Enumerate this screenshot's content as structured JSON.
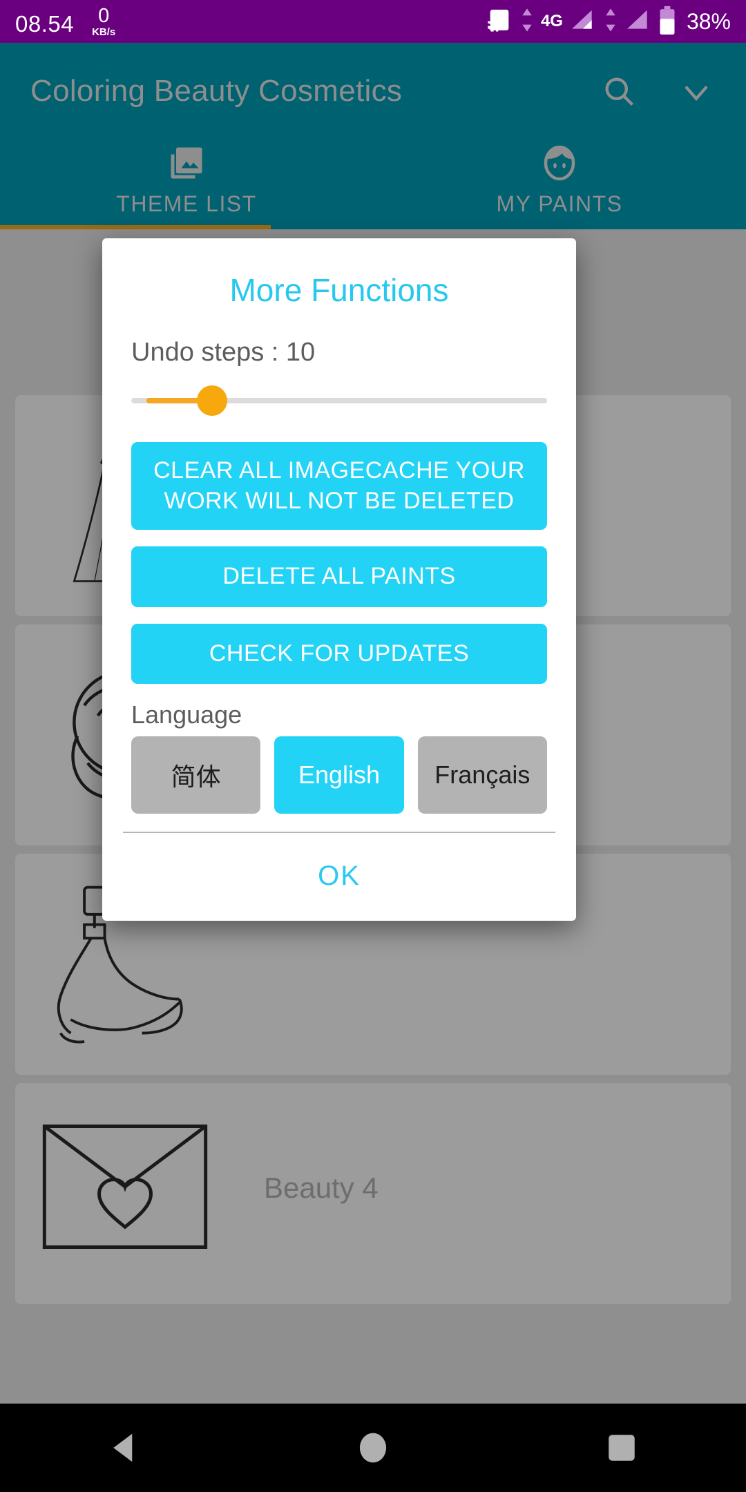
{
  "status_bar": {
    "time": "08.54",
    "net_speed_value": "0",
    "net_speed_unit": "KB/s",
    "network_type": "4G",
    "battery_percent": "38%",
    "background_color": "#6a0080",
    "icons": [
      "cast-icon",
      "mobile-data-icon",
      "signal-icon-1",
      "signal-icon-2",
      "battery-icon"
    ]
  },
  "app_bar": {
    "title": "Coloring Beauty Cosmetics",
    "background_color": "#006170",
    "search_icon": "search-icon",
    "overflow_icon": "chevron-down-icon",
    "tabs": [
      {
        "label": "THEME LIST",
        "icon": "photo-library-icon",
        "active": true
      },
      {
        "label": "MY PAINTS",
        "icon": "face-icon",
        "active": false
      }
    ],
    "indicator_color": "#9c6a12"
  },
  "content": {
    "items": [
      {
        "thumb": "dress-line-art",
        "title": ""
      },
      {
        "thumb": "rose-line-art",
        "title": ""
      },
      {
        "thumb": "high-heel-shoe-line-art",
        "title": ""
      },
      {
        "thumb": "envelope-heart-line-art",
        "title": "Beauty 4"
      }
    ]
  },
  "dialog": {
    "title": "More Functions",
    "title_color": "#27c8f0",
    "undo_label": "Undo steps : 10",
    "slider": {
      "value": 10,
      "min": 0,
      "max": 30,
      "fill_color": "#f5a623",
      "thumb_color": "#f7a80d",
      "track_color": "#dcdcdc"
    },
    "buttons": [
      {
        "id": "clear-cache",
        "label": "CLEAR ALL IMAGECACHE YOUR WORK WILL NOT BE DELETED"
      },
      {
        "id": "delete-paints",
        "label": "DELETE ALL PAINTS"
      },
      {
        "id": "check-updates",
        "label": "CHECK FOR UPDATES"
      }
    ],
    "button_color": "#22d3f5",
    "language_label": "Language",
    "languages": [
      {
        "label": "简体",
        "selected": false
      },
      {
        "label": "English",
        "selected": true
      },
      {
        "label": "Français",
        "selected": false
      }
    ],
    "ok_label": "OK"
  },
  "nav_bar": {
    "background_color": "#000000",
    "buttons": [
      "back-icon",
      "home-icon",
      "recents-icon"
    ]
  }
}
